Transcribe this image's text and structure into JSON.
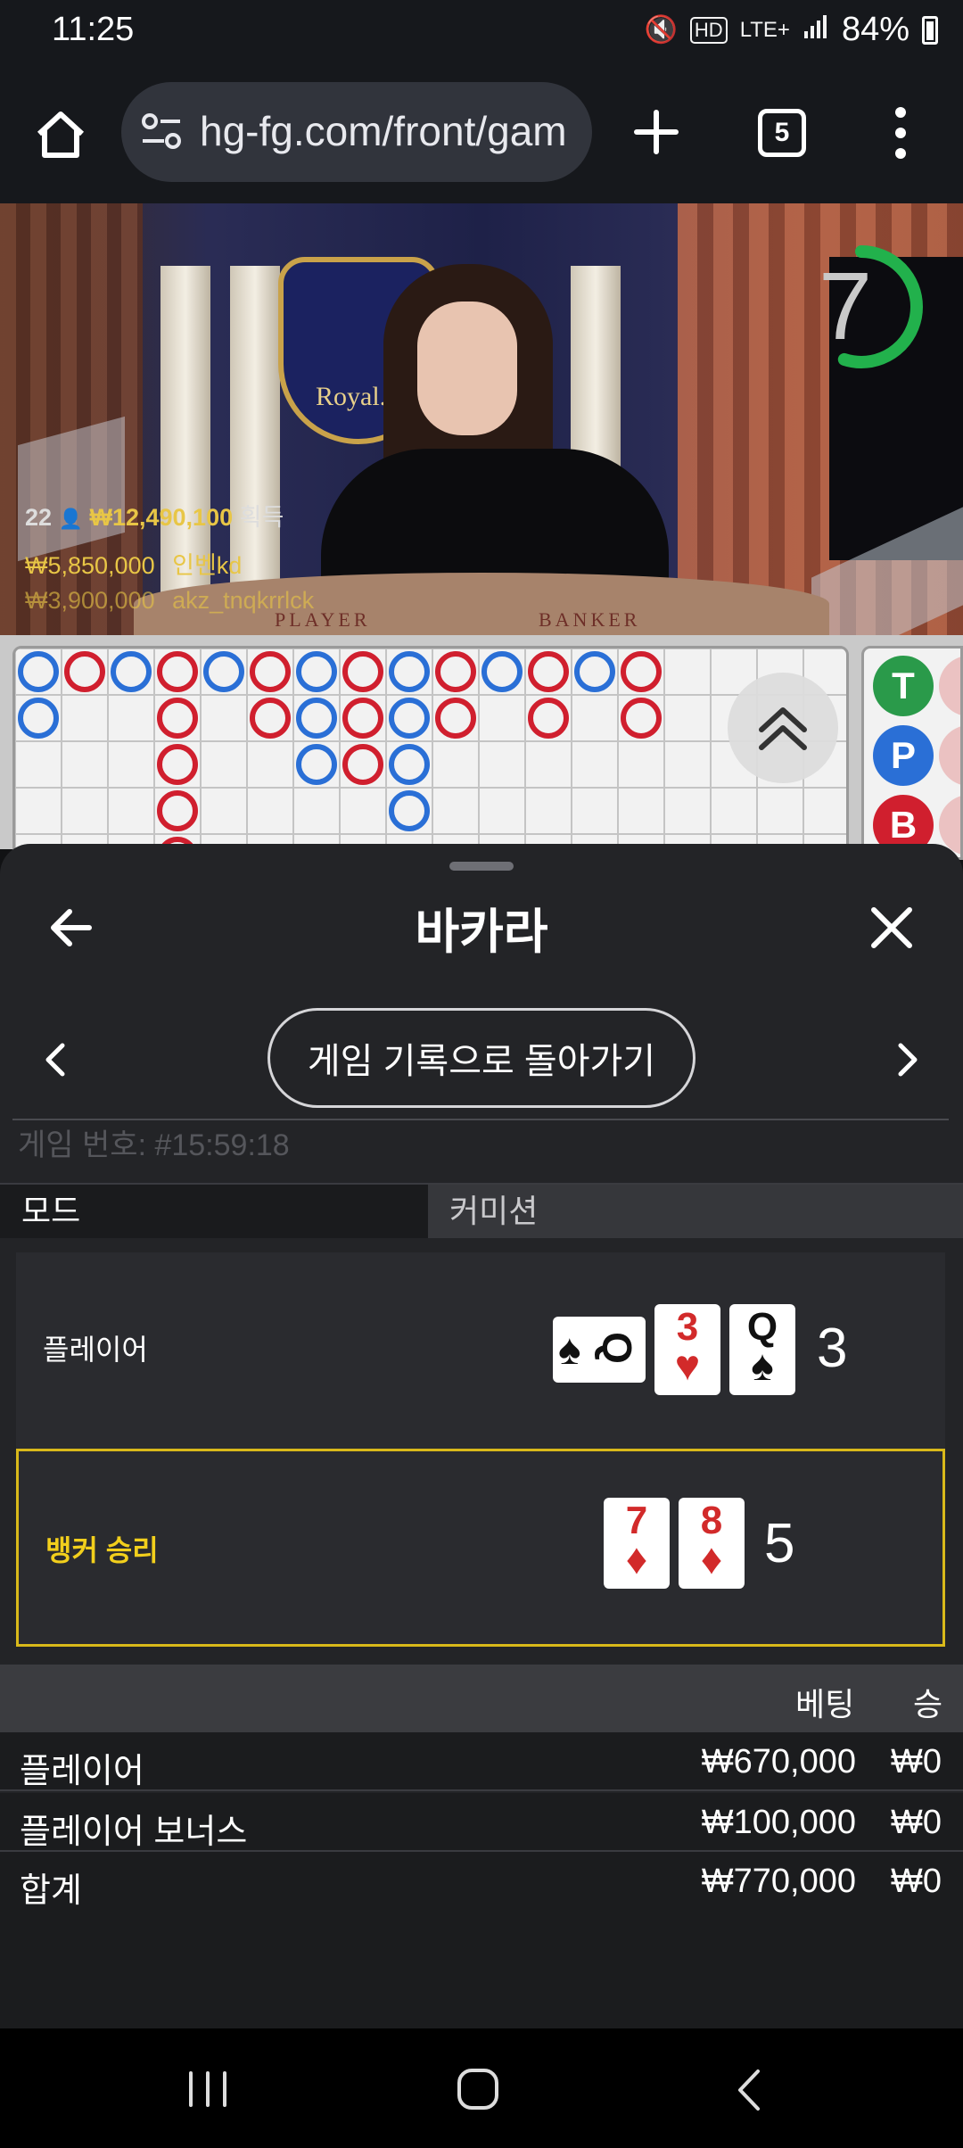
{
  "status_bar": {
    "time": "11:25",
    "network": "LTE+",
    "battery": "84%"
  },
  "browser": {
    "url": "hg-fg.com/front/gam",
    "tab_count": "5"
  },
  "video": {
    "logo_text": "Royal.kr",
    "timer": "7",
    "timer_fraction": 0.55,
    "table_player_label": "PLAYER",
    "table_banker_label": "BANKER",
    "winners": [
      {
        "count": "22",
        "amount": "₩12,490,100",
        "suffix": "획득"
      },
      {
        "amount": "₩5,850,000",
        "name": "인벤kd"
      },
      {
        "amount": "₩3,900,000",
        "name": "akz_tnqkrrlck"
      }
    ]
  },
  "roadmap": {
    "big_road": [
      [
        "P",
        "P"
      ],
      [
        "B"
      ],
      [
        "P"
      ],
      [
        "B",
        "B",
        "B",
        "B",
        "B"
      ],
      [
        "P"
      ],
      [
        "B",
        "B"
      ],
      [
        "P",
        "P",
        "P"
      ],
      [
        "B",
        "B",
        "B"
      ],
      [
        "P",
        "P",
        "P",
        "P"
      ],
      [
        "B",
        "B"
      ],
      [
        "P"
      ],
      [
        "B",
        "B"
      ],
      [
        "P"
      ],
      [
        "B",
        "B"
      ]
    ],
    "side_stats": [
      "T",
      "P",
      "B"
    ]
  },
  "sheet": {
    "title": "바카라",
    "back_to_history": "게임 기록으로 돌아가기",
    "game_number": "게임 번호: #15:59:18",
    "tab_mode": "모드",
    "tab_commission": "커미션",
    "player": {
      "label": "플레이어",
      "total": "3",
      "cards": [
        {
          "rank": "Q",
          "suit": "♠",
          "color": "black",
          "sideways": true
        },
        {
          "rank": "3",
          "suit": "♥",
          "color": "red"
        },
        {
          "rank": "Q",
          "suit": "♠",
          "color": "black"
        }
      ]
    },
    "banker": {
      "label": "뱅커 승리",
      "total": "5",
      "cards": [
        {
          "rank": "7",
          "suit": "♦",
          "color": "red"
        },
        {
          "rank": "8",
          "suit": "♦",
          "color": "red"
        }
      ]
    },
    "bets_header": {
      "bet": "베팅",
      "win": "승"
    },
    "bets": [
      {
        "label": "플레이어",
        "bet": "₩670,000",
        "win": "₩0"
      },
      {
        "label": "플레이어 보너스",
        "bet": "₩100,000",
        "win": "₩0"
      },
      {
        "label": "합계",
        "bet": "₩770,000",
        "win": "₩0"
      }
    ]
  },
  "colors": {
    "banker_red": "#d01f2e",
    "player_blue": "#2a6fd6",
    "win_gold": "#f2cf1c",
    "timer_green": "#22b14c"
  }
}
